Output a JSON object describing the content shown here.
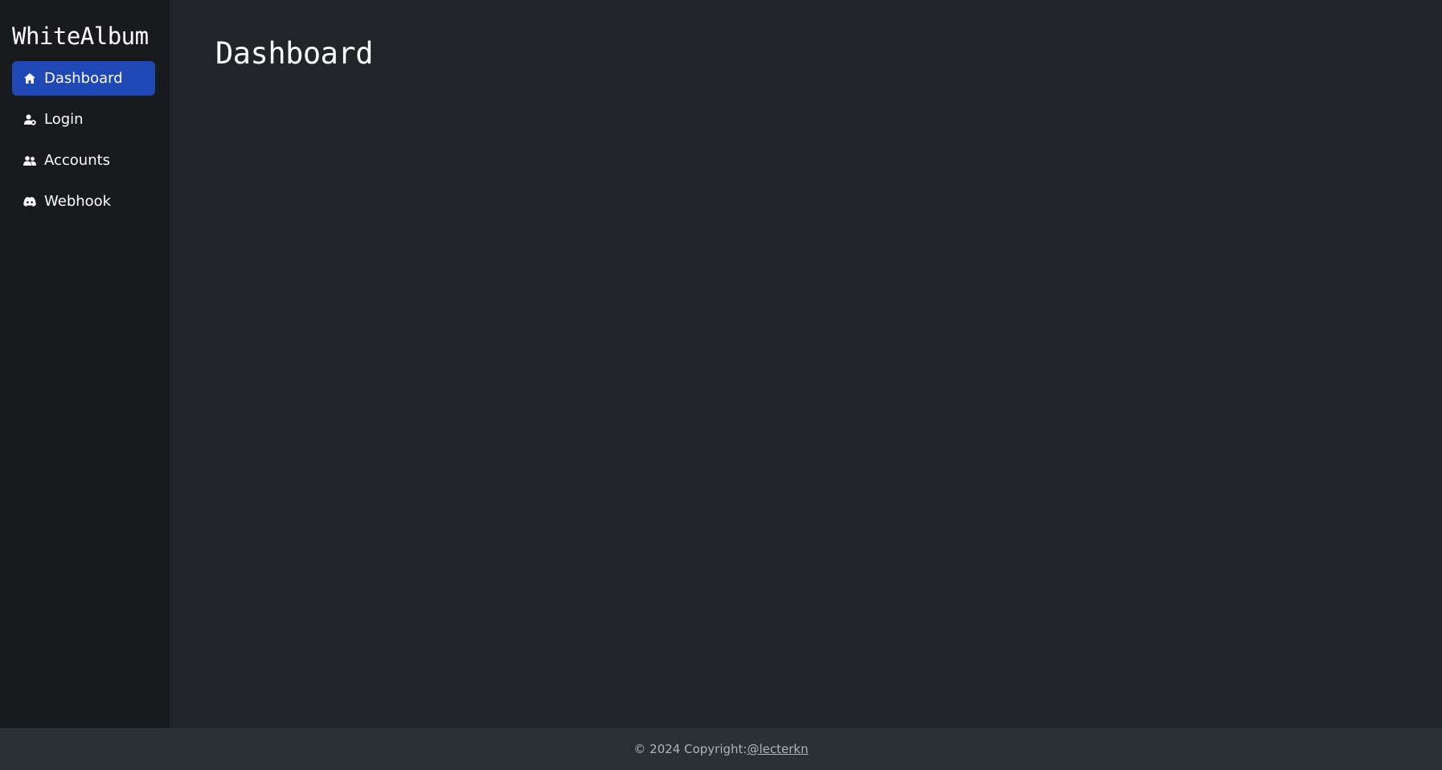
{
  "app": {
    "brand": "WhiteAlbum"
  },
  "sidebar": {
    "items": [
      {
        "label": "Dashboard",
        "icon": "home-icon",
        "active": true
      },
      {
        "label": "Login",
        "icon": "user-login-icon",
        "active": false
      },
      {
        "label": "Accounts",
        "icon": "users-icon",
        "active": false
      },
      {
        "label": "Webhook",
        "icon": "discord-icon",
        "active": false
      }
    ]
  },
  "main": {
    "title": "Dashboard"
  },
  "footer": {
    "copyright": "© 2024 Copyright: ",
    "link_label": "@lecterkn"
  },
  "colors": {
    "sidebar_bg": "#181a1d",
    "main_bg": "#212529",
    "active_item_bg": "#1f47b6",
    "footer_bg": "#2b3035",
    "footer_text": "#aeb4bb"
  }
}
